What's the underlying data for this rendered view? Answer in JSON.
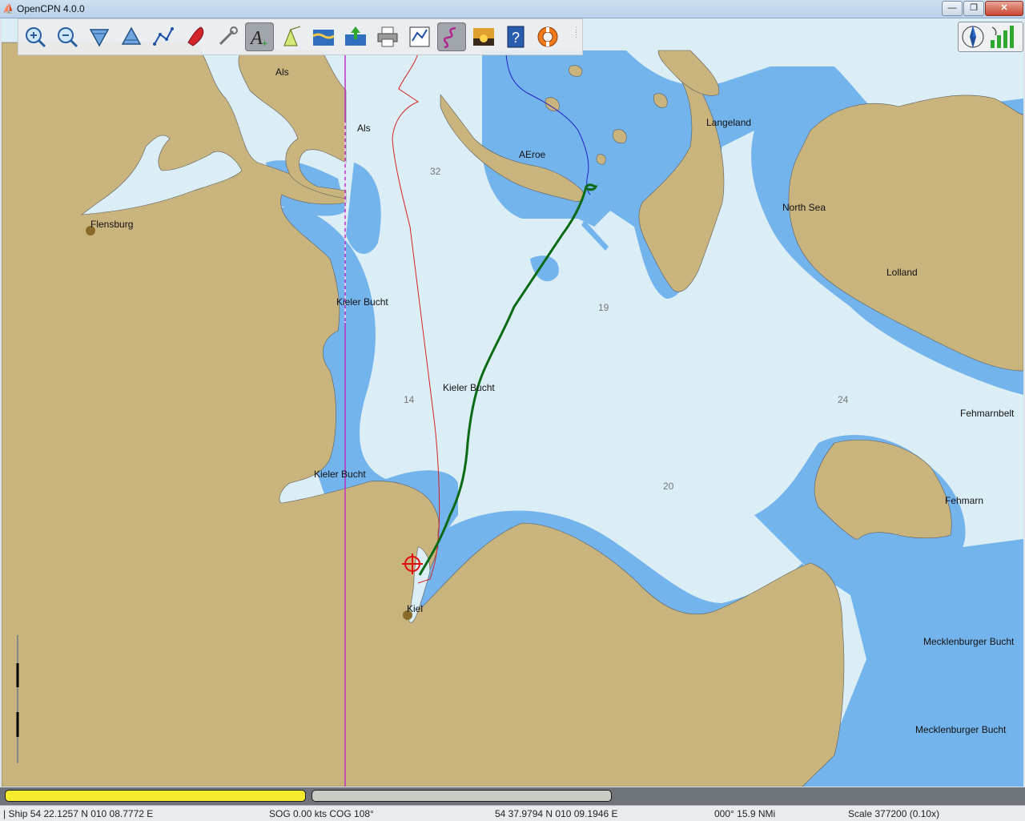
{
  "window": {
    "title": "OpenCPN 4.0.0",
    "minimize": "—",
    "maximize": "❐",
    "close": "✕"
  },
  "toolbar": {
    "tools": [
      {
        "name": "zoom-in-icon",
        "tip": "Zoom In"
      },
      {
        "name": "zoom-out-icon",
        "tip": "Zoom Out"
      },
      {
        "name": "scale-down-icon",
        "tip": "Shift Down"
      },
      {
        "name": "scale-up-icon",
        "tip": "Shift Up"
      },
      {
        "name": "route-icon",
        "tip": "Create Route"
      },
      {
        "name": "follow-ship-icon",
        "tip": "Auto Follow"
      },
      {
        "name": "settings-icon",
        "tip": "Options"
      },
      {
        "name": "text-icon",
        "tip": "Show ENC Text"
      },
      {
        "name": "ais-icon",
        "tip": "AIS"
      },
      {
        "name": "tide-icon",
        "tip": "Tides"
      },
      {
        "name": "current-icon",
        "tip": "Currents"
      },
      {
        "name": "print-icon",
        "tip": "Print Chart"
      },
      {
        "name": "route-manager-icon",
        "tip": "Route Manager"
      },
      {
        "name": "track-icon",
        "tip": "Enable Tracking"
      },
      {
        "name": "color-scheme-icon",
        "tip": "Change Color Scheme"
      },
      {
        "name": "help-icon",
        "tip": "About"
      },
      {
        "name": "mob-icon",
        "tip": "Man Overboard"
      }
    ]
  },
  "chart": {
    "labels": {
      "als1": "Als",
      "als2": "Als",
      "aeroe": "AEroe",
      "langeland": "Langeland",
      "north_sea": "North Sea",
      "lolland": "Lolland",
      "flensburg": "Flensburg",
      "kieler_bucht_1": "Kieler Bucht",
      "kieler_bucht_2": "Kieler Bucht",
      "kieler_bucht_3": "Kieler Bucht",
      "fehmarnbelt": "Fehmarnbelt",
      "fehmarn": "Fehmarn",
      "kiel": "Kiel",
      "mecklenburger_1": "Mecklenburger Bucht",
      "mecklenburger_2": "Mecklenburger Bucht"
    },
    "soundings": {
      "s32": "32",
      "s19": "19",
      "s14": "14",
      "s24": "24",
      "s20": "20"
    },
    "colors": {
      "land": "#c9b47e",
      "shallow": "#74b4ec",
      "deep": "#dbeef5",
      "track": "#0b6a16",
      "route_red": "#d62020",
      "route_blue": "#2020c0",
      "meridian": "#c030c0"
    }
  },
  "status": {
    "ship": "| Ship 54 22.1257 N   010 08.7772 E",
    "sog_cog": "SOG 0.00 kts  COG 108°",
    "cursor": "54 37.9794 N   010 09.1946 E",
    "bearing": "000°  15.9 NMi",
    "scale": "Scale 377200 (0.10x)"
  },
  "piano": {
    "key1_color": "#f4ec2c",
    "key2_color": "#c9ccc4"
  }
}
